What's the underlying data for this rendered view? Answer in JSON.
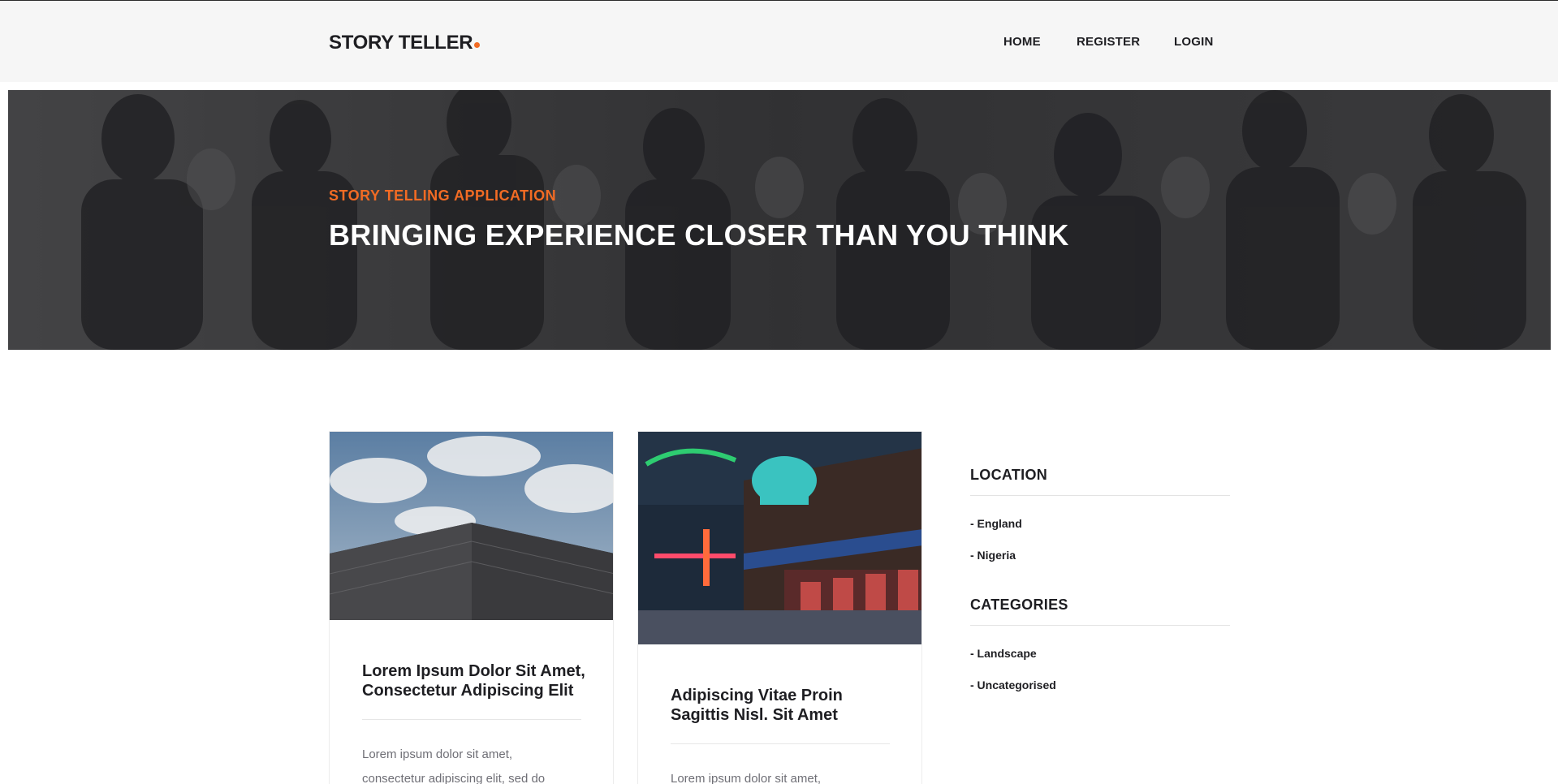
{
  "header": {
    "logo": "STORY TELLER",
    "nav": [
      {
        "label": "HOME"
      },
      {
        "label": "REGISTER"
      },
      {
        "label": "LOGIN"
      }
    ]
  },
  "hero": {
    "subtitle": "STORY TELLING APPLICATION",
    "title": "BRINGING EXPERIENCE CLOSER THAN YOU THINK"
  },
  "posts": [
    {
      "title": "Lorem Ipsum Dolor Sit Amet, Consectetur Adipiscing Elit",
      "excerpt": "Lorem ipsum dolor sit amet, consectetur adipiscing elit, sed do"
    },
    {
      "title": "Adipiscing Vitae Proin Sagittis Nisl. Sit Amet",
      "excerpt": "Lorem ipsum dolor sit amet,"
    }
  ],
  "sidebar": {
    "location_heading": "LOCATION",
    "locations": [
      "- England",
      "- Nigeria"
    ],
    "categories_heading": "CATEGORIES",
    "categories": [
      "- Landscape",
      "- Uncategorised"
    ]
  },
  "colors": {
    "accent": "#f26b24",
    "header_bg": "#f6f6f6",
    "text_dark": "#1e1e22",
    "text_muted": "#6f6f76"
  }
}
